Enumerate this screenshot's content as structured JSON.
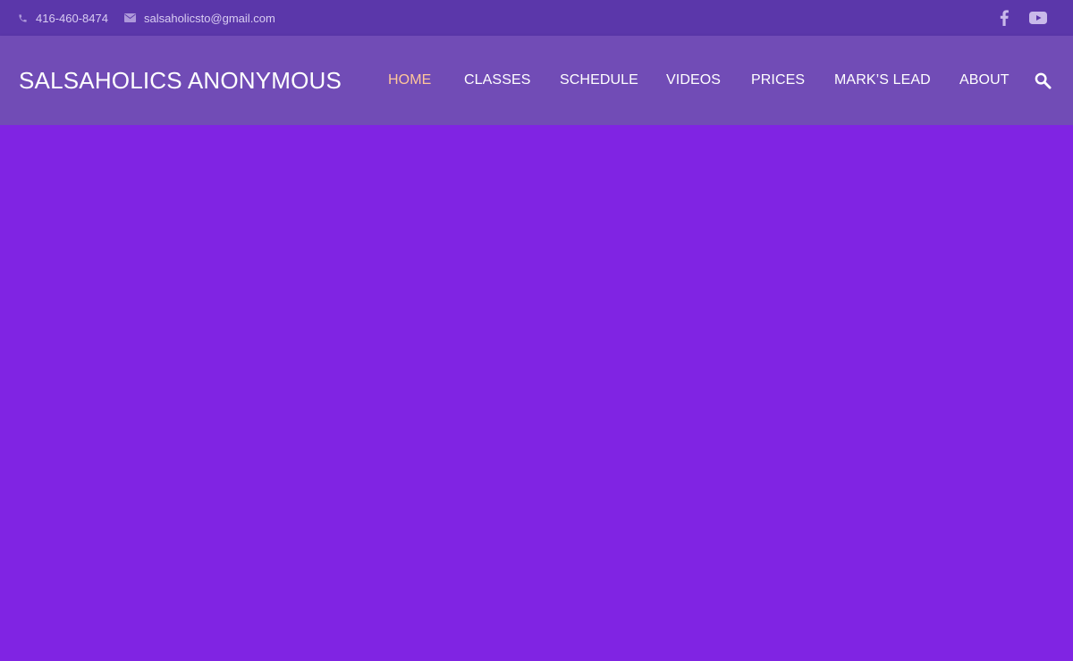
{
  "topbar": {
    "phone": "416-460-8474",
    "email": "salsaholicsto@gmail.com",
    "phone_icon": "phone-icon",
    "email_icon": "envelope-icon",
    "social": [
      "facebook-icon",
      "youtube-icon"
    ]
  },
  "header": {
    "brand": "SALSAHOLICS ANONYMOUS",
    "nav": [
      {
        "label": "HOME",
        "active": true
      },
      {
        "label": "CLASSES",
        "active": false
      },
      {
        "label": "SCHEDULE",
        "active": false
      },
      {
        "label": "VIDEOS",
        "active": false
      },
      {
        "label": "PRICES",
        "active": false
      },
      {
        "label": "MARK’S LEAD",
        "active": false
      },
      {
        "label": "ABOUT",
        "active": false
      }
    ],
    "search_icon": "search-icon"
  },
  "colors": {
    "topbar_bg": "#5b37aa",
    "navbar_bg": "#714cb6",
    "page_bg": "#8024e3",
    "active_nav": "#ffc79a",
    "nav_text": "#ffffff"
  }
}
